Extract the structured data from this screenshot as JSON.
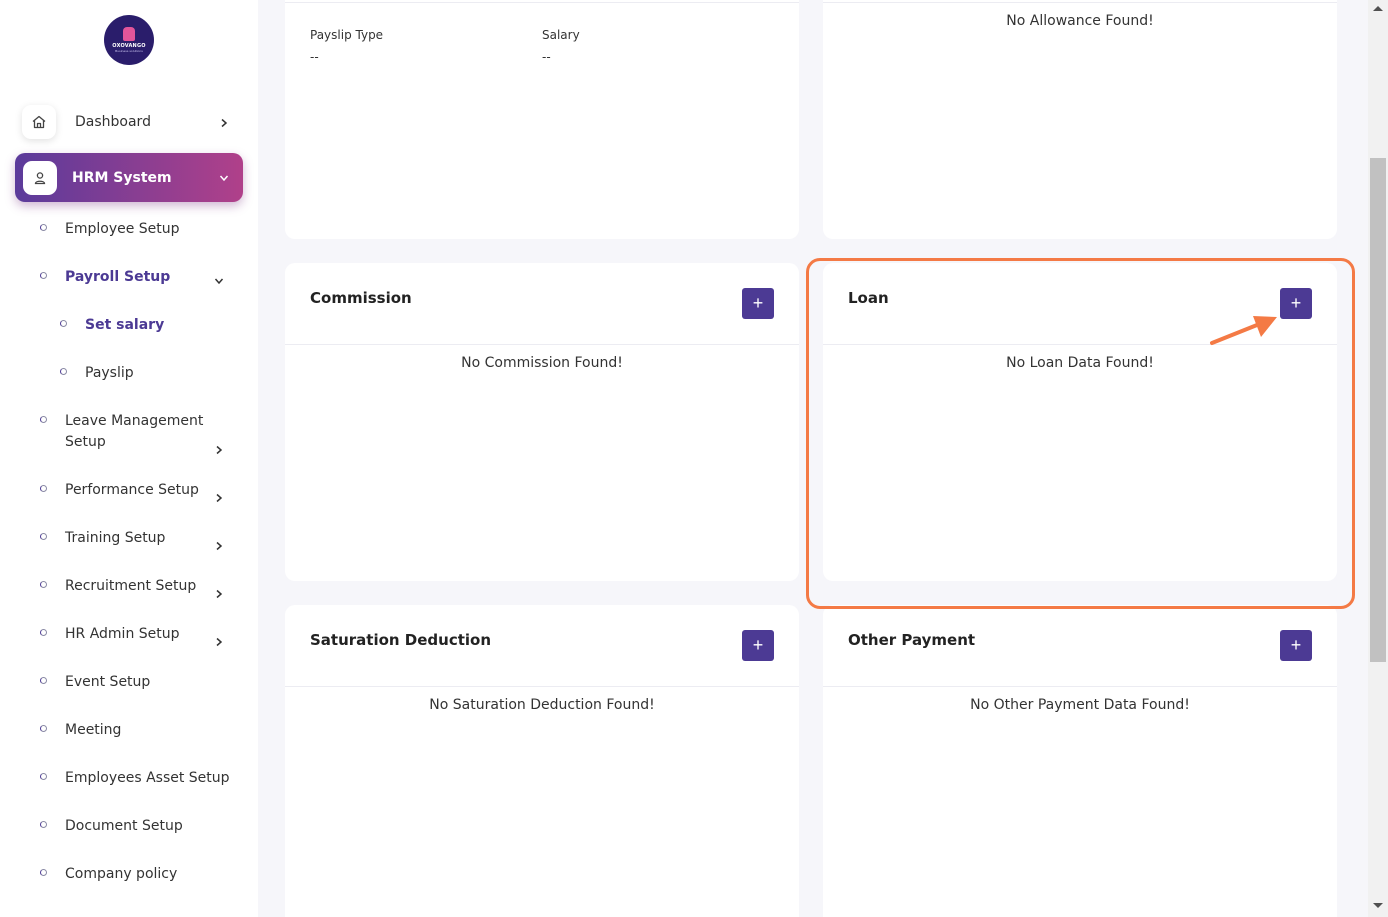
{
  "logo": {
    "name": "OXOVANGO",
    "tagline": "Business solutions"
  },
  "sidebar": {
    "dashboard": {
      "label": "Dashboard",
      "icon": "home-icon"
    },
    "hrm": {
      "label": "HRM System",
      "icon": "user-icon"
    },
    "items": [
      {
        "label": "Employee Setup"
      },
      {
        "label": "Payroll Setup"
      },
      {
        "label": "Set salary"
      },
      {
        "label": "Payslip"
      },
      {
        "label": "Leave Management Setup"
      },
      {
        "label": "Performance Setup"
      },
      {
        "label": "Training Setup"
      },
      {
        "label": "Recruitment Setup"
      },
      {
        "label": "HR Admin Setup"
      },
      {
        "label": "Event Setup"
      },
      {
        "label": "Meeting"
      },
      {
        "label": "Employees Asset Setup"
      },
      {
        "label": "Document Setup"
      },
      {
        "label": "Company policy"
      }
    ]
  },
  "payslip_card": {
    "type_label": "Payslip Type",
    "type_value": "--",
    "salary_label": "Salary",
    "salary_value": "--"
  },
  "allowance_card": {
    "empty_text": "No Allowance Found!"
  },
  "commission_card": {
    "title": "Commission",
    "empty_text": "No Commission Found!",
    "add_label": "+"
  },
  "loan_card": {
    "title": "Loan",
    "empty_text": "No Loan Data Found!",
    "add_label": "+"
  },
  "saturation_card": {
    "title": "Saturation Deduction",
    "empty_text": "No Saturation Deduction Found!",
    "add_label": "+"
  },
  "other_payment_card": {
    "title": "Other Payment",
    "empty_text": "No Other Payment Data Found!",
    "add_label": "+"
  },
  "colors": {
    "accent": "#4c3a94",
    "highlight": "#f47a45",
    "gradient_start": "#5b3b9b",
    "gradient_end": "#b0408a"
  }
}
